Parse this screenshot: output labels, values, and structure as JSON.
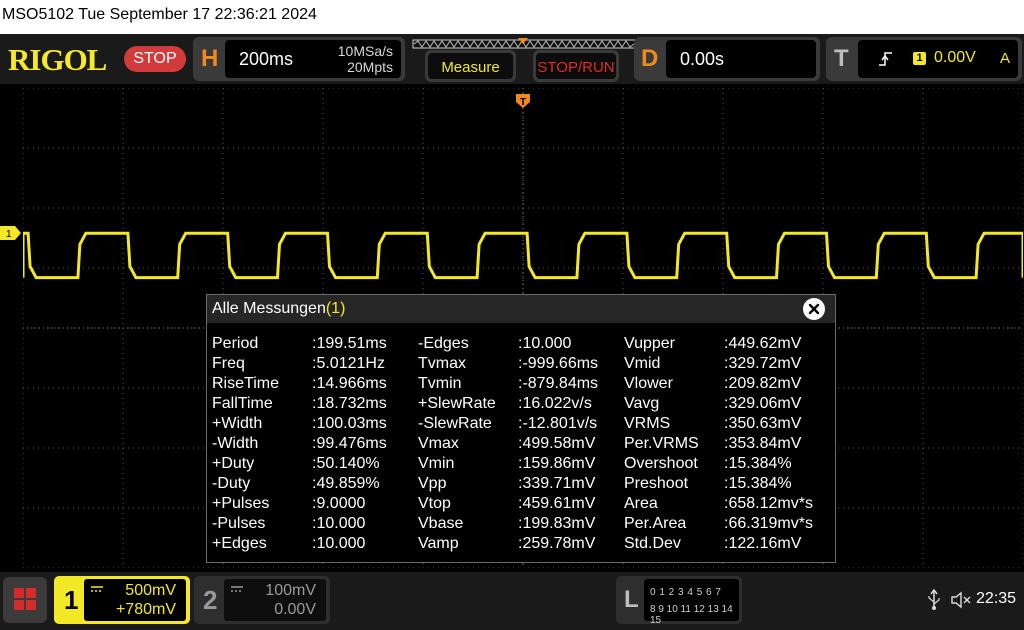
{
  "window": {
    "title": "MSO5102  Tue September 17 22:36:21 2024"
  },
  "toolbar": {
    "logo": "RIGOL",
    "run_state": "STOP",
    "horizontal": {
      "letter": "H",
      "timebase": "200ms",
      "sample_rate": "10MSa/s",
      "memory_depth": "20Mpts"
    },
    "measure_button": "Measure",
    "stop_run_button": "STOP/RUN",
    "delay": {
      "letter": "D",
      "value": "0.00s"
    },
    "trigger": {
      "letter": "T",
      "source": "1",
      "level": "0.00V",
      "mode": "A"
    }
  },
  "colors": {
    "ch1": "#f3e825",
    "stop": "#d13b3b",
    "horizontal": "#f08a1c",
    "measure_text": "#f3e825",
    "stop_run_text": "#e02b2b"
  },
  "trace": {
    "channel": "1",
    "signal_type": "square",
    "period_divisions": 0.998,
    "duty": 0.5014,
    "high_level_divisions": 1.58,
    "low_level_divisions": 0.84
  },
  "measurements": {
    "title": "Alle Messungen",
    "channel": "(1)",
    "columns": [
      [
        {
          "name": "Period",
          "value": ":199.51ms"
        },
        {
          "name": "Freq",
          "value": ":5.0121Hz"
        },
        {
          "name": "RiseTime",
          "value": ":14.966ms"
        },
        {
          "name": "FallTime",
          "value": ":18.732ms"
        },
        {
          "name": "+Width",
          "value": ":100.03ms"
        },
        {
          "name": "-Width",
          "value": ":99.476ms"
        },
        {
          "name": "+Duty",
          "value": ":50.140%"
        },
        {
          "name": "-Duty",
          "value": ":49.859%"
        },
        {
          "name": "+Pulses",
          "value": ":9.0000"
        },
        {
          "name": "-Pulses",
          "value": ":10.000"
        },
        {
          "name": "+Edges",
          "value": ":10.000"
        }
      ],
      [
        {
          "name": "-Edges",
          "value": ":10.000"
        },
        {
          "name": "Tvmax",
          "value": ":-999.66ms"
        },
        {
          "name": "Tvmin",
          "value": ":-879.84ms"
        },
        {
          "name": "+SlewRate",
          "value": ":16.022v/s"
        },
        {
          "name": "-SlewRate",
          "value": ":-12.801v/s"
        },
        {
          "name": "Vmax",
          "value": ":499.58mV"
        },
        {
          "name": "Vmin",
          "value": ":159.86mV"
        },
        {
          "name": "Vpp",
          "value": ":339.71mV"
        },
        {
          "name": "Vtop",
          "value": ":459.61mV"
        },
        {
          "name": "Vbase",
          "value": ":199.83mV"
        },
        {
          "name": "Vamp",
          "value": ":259.78mV"
        }
      ],
      [
        {
          "name": "Vupper",
          "value": ":449.62mV"
        },
        {
          "name": "Vmid",
          "value": ":329.72mV"
        },
        {
          "name": "Vlower",
          "value": ":209.82mV"
        },
        {
          "name": "Vavg",
          "value": ":329.06mV"
        },
        {
          "name": "VRMS",
          "value": ":350.63mV"
        },
        {
          "name": "Per.VRMS",
          "value": ":353.84mV"
        },
        {
          "name": "Overshoot",
          "value": ":15.384%"
        },
        {
          "name": "Preshoot",
          "value": ":15.384%"
        },
        {
          "name": "Area",
          "value": ":658.12mv*s"
        },
        {
          "name": "Per.Area",
          "value": ":66.319mv*s"
        },
        {
          "name": "Std.Dev",
          "value": ":122.16mV"
        }
      ]
    ]
  },
  "bottombar": {
    "ch1": {
      "number": "1",
      "scale": "500mV",
      "offset": "+780mV"
    },
    "ch2": {
      "number": "2",
      "scale": "100mV",
      "offset": "0.00V"
    },
    "logic": {
      "letter": "L",
      "row1": "0 1 2 3  4 5 6 7",
      "row2": "8 9 10 11 12 13 14 15"
    },
    "clock": "22:35"
  }
}
